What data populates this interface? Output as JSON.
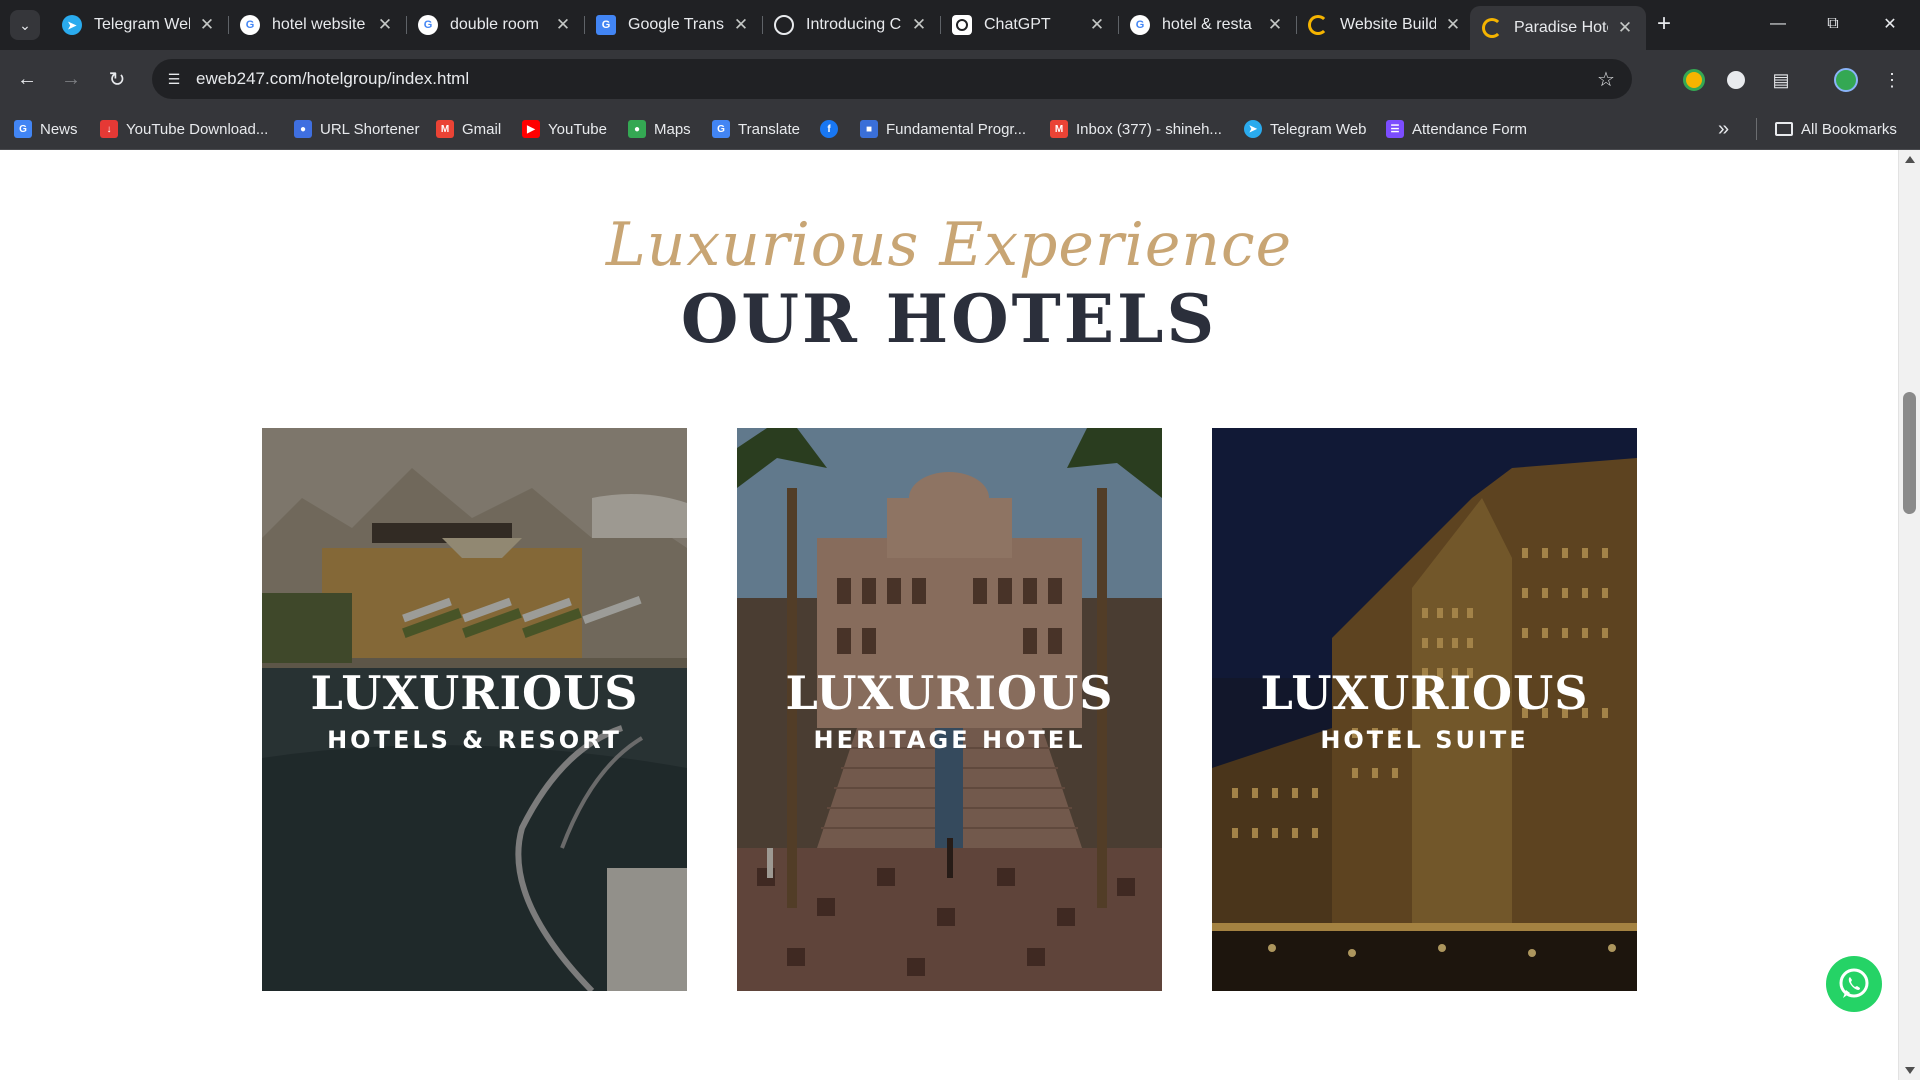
{
  "browser": {
    "tab_search_icon": "chevron-down-icon",
    "tabs": [
      {
        "title": "Telegram Web",
        "favicon": "telegram",
        "color": "#2aabee",
        "active": false
      },
      {
        "title": "hotel website",
        "favicon": "google",
        "color": "#4285f4",
        "active": false
      },
      {
        "title": "double room",
        "favicon": "google",
        "color": "#4285f4",
        "active": false
      },
      {
        "title": "Google Transl",
        "favicon": "google-translate",
        "color": "#4285f4",
        "active": false
      },
      {
        "title": "Introducing C",
        "favicon": "openai",
        "color": "#444444",
        "active": false
      },
      {
        "title": "ChatGPT",
        "favicon": "openai",
        "color": "#444444",
        "active": false
      },
      {
        "title": "hotel & resta",
        "favicon": "google",
        "color": "#4285f4",
        "active": false
      },
      {
        "title": "Website Build",
        "favicon": "builder",
        "color": "#f5b400",
        "active": false
      },
      {
        "title": "Paradise Hote",
        "favicon": "builder",
        "color": "#f5b400",
        "active": true
      }
    ],
    "new_tab_label": "+",
    "url": "eweb247.com/hotelgroup/index.html",
    "bookmarks": [
      {
        "label": "News",
        "color": "#4285f4"
      },
      {
        "label": "YouTube Download...",
        "color": "#e53935"
      },
      {
        "label": "URL Shortener",
        "color": "#3f6fe0"
      },
      {
        "label": "Gmail",
        "color": "#ea4335"
      },
      {
        "label": "YouTube",
        "color": "#ff0000"
      },
      {
        "label": "Maps",
        "color": "#34a853"
      },
      {
        "label": "Translate",
        "color": "#4285f4"
      },
      {
        "label": "",
        "color": "#1877f2"
      },
      {
        "label": "Fundamental Progr...",
        "color": "#3a6fd8"
      },
      {
        "label": "Inbox (377) - shineh...",
        "color": "#ea4335"
      },
      {
        "label": "Telegram Web",
        "color": "#2aabee"
      },
      {
        "label": "Attendance Form",
        "color": "#7c4dff"
      }
    ],
    "bookmarks_overflow": "»",
    "all_bookmarks_label": "All Bookmarks"
  },
  "page": {
    "script_heading": "Luxurious Experience",
    "heading": "OUR HOTELS",
    "accent_color": "#c8a574",
    "heading_color": "#2b2f3b",
    "cards": [
      {
        "title": "LUXURIOUS",
        "subtitle": "HOTELS & RESORT"
      },
      {
        "title": "LUXURIOUS",
        "subtitle": "HERITAGE HOTEL"
      },
      {
        "title": "LUXURIOUS",
        "subtitle": "HOTEL SUITE"
      }
    ],
    "whatsapp_icon": "whatsapp-icon"
  }
}
